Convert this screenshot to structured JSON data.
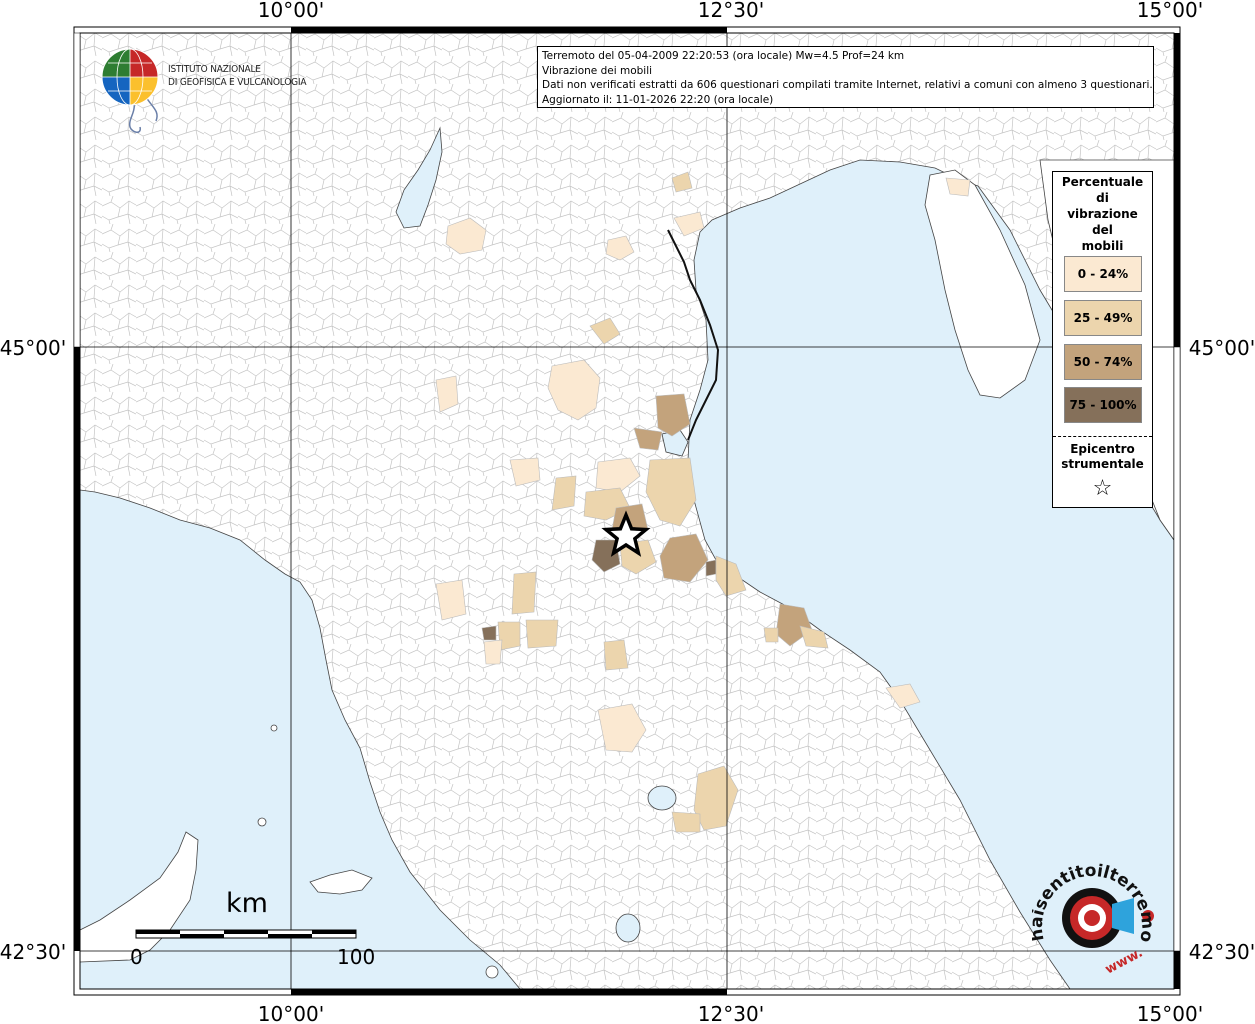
{
  "grid_labels": {
    "lon_left": "10°00'",
    "lon_mid": "12°30'",
    "lon_right": "15°00'",
    "lat_upper": "45°00'",
    "lat_lower": "42°30'"
  },
  "info": {
    "line1": "Terremoto del 05-04-2009 22:20:53 (ora locale) Mw=4.5 Prof=24 km",
    "line2": "Vibrazione dei mobili",
    "line3": "Dati non verificati estratti da 606 questionari compilati tramite Internet, relativi a comuni con almeno 3 questionari.",
    "line4": "Aggiornato il: 11-01-2026 22:20 (ora locale)"
  },
  "institute": {
    "line1": "ISTITUTO NAZIONALE",
    "line2": "DI GEOFISICA E VULCANOLOGIA"
  },
  "legend": {
    "title_lines": [
      "Percentuale",
      "di",
      "vibrazione",
      "del",
      "mobili"
    ],
    "classes": [
      {
        "label": "0 - 24%",
        "color": "#fbe9d2"
      },
      {
        "label": "25 - 49%",
        "color": "#ecd5ad"
      },
      {
        "label": "50 - 74%",
        "color": "#c3a37c"
      },
      {
        "label": "75 - 100%",
        "color": "#85705a"
      }
    ],
    "epicenter_line1": "Epicentro",
    "epicenter_line2": "strumentale",
    "epicenter_symbol": "☆"
  },
  "scale": {
    "unit": "km",
    "min": "0",
    "max": "100"
  },
  "colors": {
    "sea": "#dff0fa",
    "land": "#ffffff",
    "border": "#bbbbbb"
  },
  "epicenter": {
    "lat": 44.05,
    "lon": 11.85
  }
}
